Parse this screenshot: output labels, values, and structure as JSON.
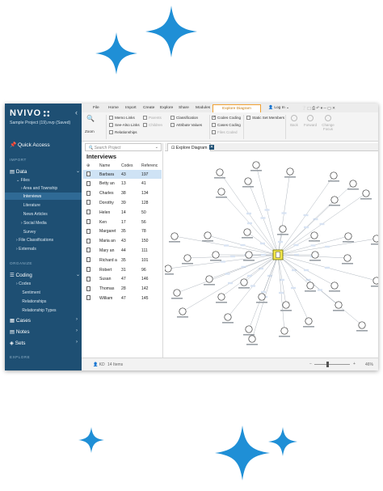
{
  "brand": {
    "logo": "NVIVO",
    "project": "Sample Project (19).nvp (Saved)"
  },
  "colors": {
    "sidebar": "#1e4f73",
    "sparkle": "#1f8fd6",
    "accent": "#f0a030",
    "selection": "#cfe3f5"
  },
  "nav": {
    "quick_access": "Quick Access",
    "import_label": "IMPORT",
    "data": "Data",
    "files": "Files",
    "area_township": "Area and Township",
    "interviews": "Interviews",
    "literature": "Literature",
    "news_articles": "News Articles",
    "social_media": "Social Media",
    "survey": "Survey",
    "file_classifications": "File Classifications",
    "externals": "Externals",
    "organize_label": "ORGANIZE",
    "coding": "Coding",
    "codes": "Codes",
    "sentiment": "Sentiment",
    "relationships": "Relationships",
    "relationship_types": "Relationship Types",
    "cases": "Cases",
    "notes": "Notes",
    "sets": "Sets",
    "explore_label": "EXPLORE"
  },
  "ribbon": {
    "tabs": [
      "File",
      "Home",
      "Import",
      "Create",
      "Explore",
      "Share",
      "Modules"
    ],
    "active_tab": "Explore Diagram",
    "login": "Log In",
    "zoom": "Zoom",
    "memo_links": "Memo Links",
    "see_also_links": "See-Also Links",
    "relationships": "Relationships",
    "parents": "Parents",
    "children": "Children",
    "classification": "Classification",
    "attribute_values": "Attribute Values",
    "codes_coding": "Codes Coding",
    "cases_coding": "Cases Coding",
    "files_coded": "Files Coded",
    "static_set_members": "Static Set Members",
    "back": "Back",
    "forward": "Forward",
    "change_focus": "Change Focus"
  },
  "list": {
    "search_placeholder": "Search Project",
    "title": "Interviews",
    "headers": {
      "name": "Name",
      "codes": "Codes",
      "refs": "Referenc"
    },
    "rows": [
      {
        "name": "Barbara",
        "codes": "43",
        "refs": "197"
      },
      {
        "name": "Betty an",
        "codes": "13",
        "refs": "41"
      },
      {
        "name": "Charles",
        "codes": "38",
        "refs": "134"
      },
      {
        "name": "Dorothy",
        "codes": "39",
        "refs": "128"
      },
      {
        "name": "Helen",
        "codes": "14",
        "refs": "50"
      },
      {
        "name": "Ken",
        "codes": "17",
        "refs": "56"
      },
      {
        "name": "Margaret",
        "codes": "35",
        "refs": "78"
      },
      {
        "name": "Maria an",
        "codes": "43",
        "refs": "150"
      },
      {
        "name": "Mary an",
        "codes": "44",
        "refs": "111"
      },
      {
        "name": "Richard a",
        "codes": "35",
        "refs": "101"
      },
      {
        "name": "Robert",
        "codes": "31",
        "refs": "96"
      },
      {
        "name": "Susan",
        "codes": "47",
        "refs": "146"
      },
      {
        "name": "Thomas",
        "codes": "28",
        "refs": "142"
      },
      {
        "name": "William",
        "codes": "47",
        "refs": "145"
      }
    ]
  },
  "diagram": {
    "tab_label": "Explore Diagram"
  },
  "status": {
    "user": "KD",
    "items": "14 Items",
    "zoom": "46%"
  }
}
